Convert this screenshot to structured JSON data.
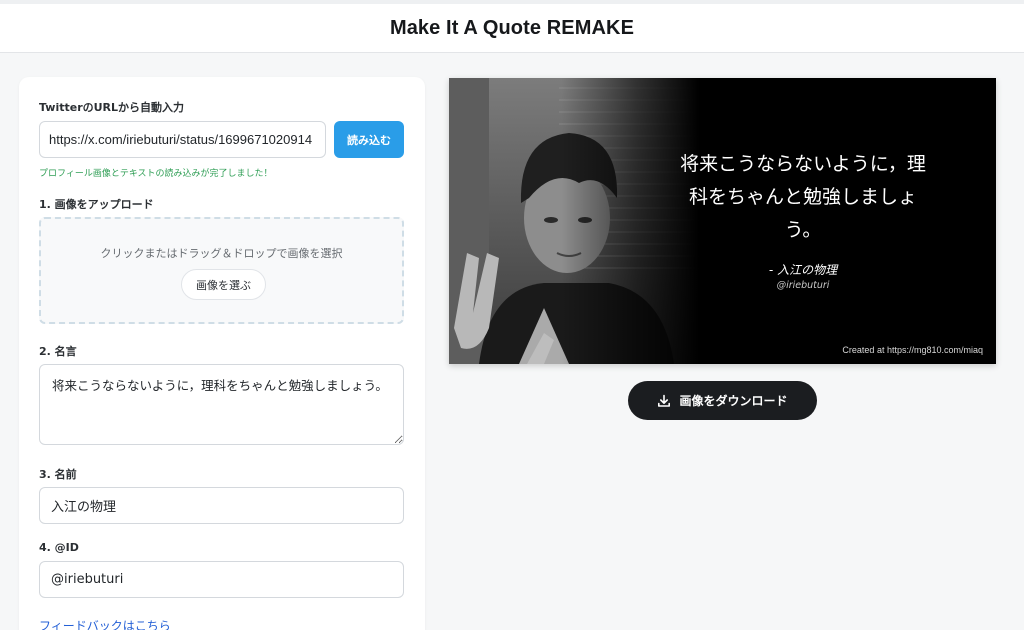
{
  "header": {
    "title": "Make It A Quote REMAKE"
  },
  "form": {
    "url_label": "TwitterのURLから自動入力",
    "url_value": "https://x.com/iriebuturi/status/1699671020914",
    "read_button": "読み込む",
    "status_message": "プロフィール画像とテキストの読み込みが完了しました！",
    "upload_label": "1. 画像をアップロード",
    "dropzone_text": "クリックまたはドラッグ＆ドロップで画像を選択",
    "choose_button": "画像を選ぶ",
    "quote_label": "2. 名言",
    "quote_value": "将来こうならないように，理科をちゃんと勉強しましょう。",
    "name_label": "3. 名前",
    "name_value": "入江の物理",
    "id_label": "4. @ID",
    "id_value": "@iriebuturi",
    "feedback_link": "フィードバックはこちら"
  },
  "preview": {
    "quote_line1": "将来こうならないように，理",
    "quote_line2": "科をちゃんと勉強しましょ",
    "quote_line3": "う。",
    "name": "- 入江の物理",
    "handle": "@iriebuturi",
    "credit": "Created at https://mg810.com/miaq",
    "background_color": "#000000",
    "text_color": "#ffffff"
  },
  "download": {
    "label": "画像をダウンロード",
    "icon": "download-icon"
  },
  "colors": {
    "accent": "#2a9de8",
    "success": "#2f9e55",
    "link": "#2460d6",
    "dark_button": "#1b1d20"
  }
}
